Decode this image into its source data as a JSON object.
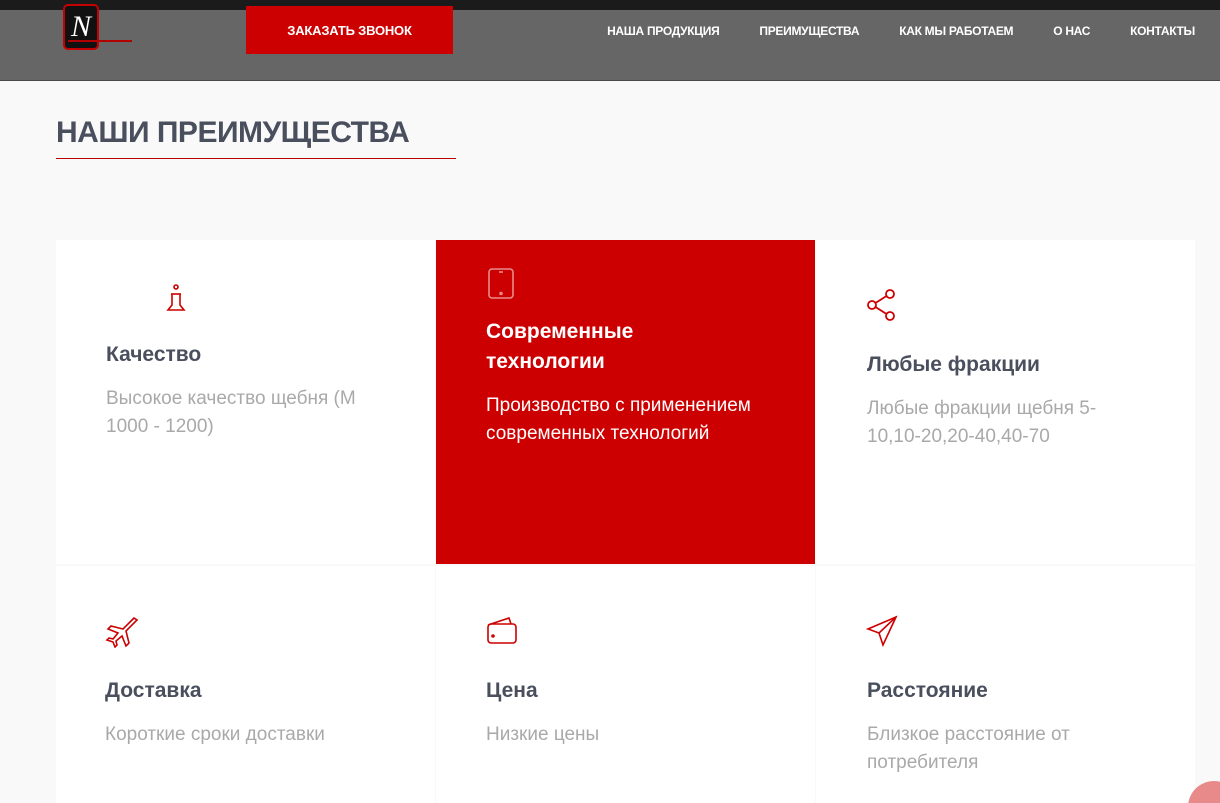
{
  "header": {
    "logo_letter": "N",
    "cta_label": "ЗАКАЗАТЬ ЗВОНОК",
    "nav": [
      "НАША ПРОДУКЦИЯ",
      "ПРЕИМУЩЕСТВА",
      "КАК МЫ РАБОТАЕМ",
      "О НАС",
      "КОНТАКТЫ"
    ]
  },
  "section": {
    "title": "НАШИ ПРЕИМУЩЕСТВА"
  },
  "features": [
    {
      "icon": "flask-icon",
      "title": "Качество",
      "text": "Высокое качество щебня (М 1000 - 1200)"
    },
    {
      "icon": "tablet-icon",
      "title": "Современные технологии",
      "text": "Производство с применением современных технологий"
    },
    {
      "icon": "share-icon",
      "title": "Любые фракции",
      "text": "Любые фракции щебня 5-10,10-20,20-40,40-70"
    },
    {
      "icon": "airplane-icon",
      "title": "Доставка",
      "text": "Короткие сроки доставки"
    },
    {
      "icon": "wallet-icon",
      "title": "Цена",
      "text": "Низкие цены"
    },
    {
      "icon": "paper-plane-icon",
      "title": "Расстояние",
      "text": "Близкое расстояние от потребителя"
    }
  ],
  "colors": {
    "accent": "#cc0000",
    "header_bg": "#666666",
    "title": "#4a4f5e",
    "muted_text": "#a9a9a9"
  }
}
